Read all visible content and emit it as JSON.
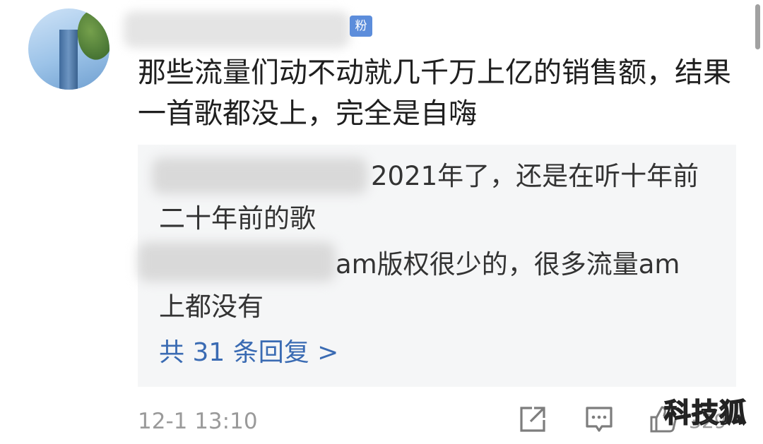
{
  "comment": {
    "badge_text": "粉",
    "text": "那些流量们动不动就几千万上亿的销售额，结果一首歌都没上，完全是自嗨"
  },
  "replies": {
    "first": {
      "text_line1": "2021年了，还是在听十年前",
      "text_line2": "二十年前的歌"
    },
    "second": {
      "text_line1": "am版权很少的，很多流量am",
      "text_line2": "上都没有"
    },
    "more_label": "共 31 条回复 >"
  },
  "footer": {
    "timestamp": "12-1 13:10",
    "like_count": "329",
    "icons": [
      "share-icon",
      "comment-icon",
      "like-icon"
    ]
  },
  "watermark": "科技狐",
  "colors": {
    "link": "#3a6bb3",
    "reply_bg": "#f5f6f7",
    "badge": "#5c8ddb",
    "meta": "#9a9a9a"
  }
}
